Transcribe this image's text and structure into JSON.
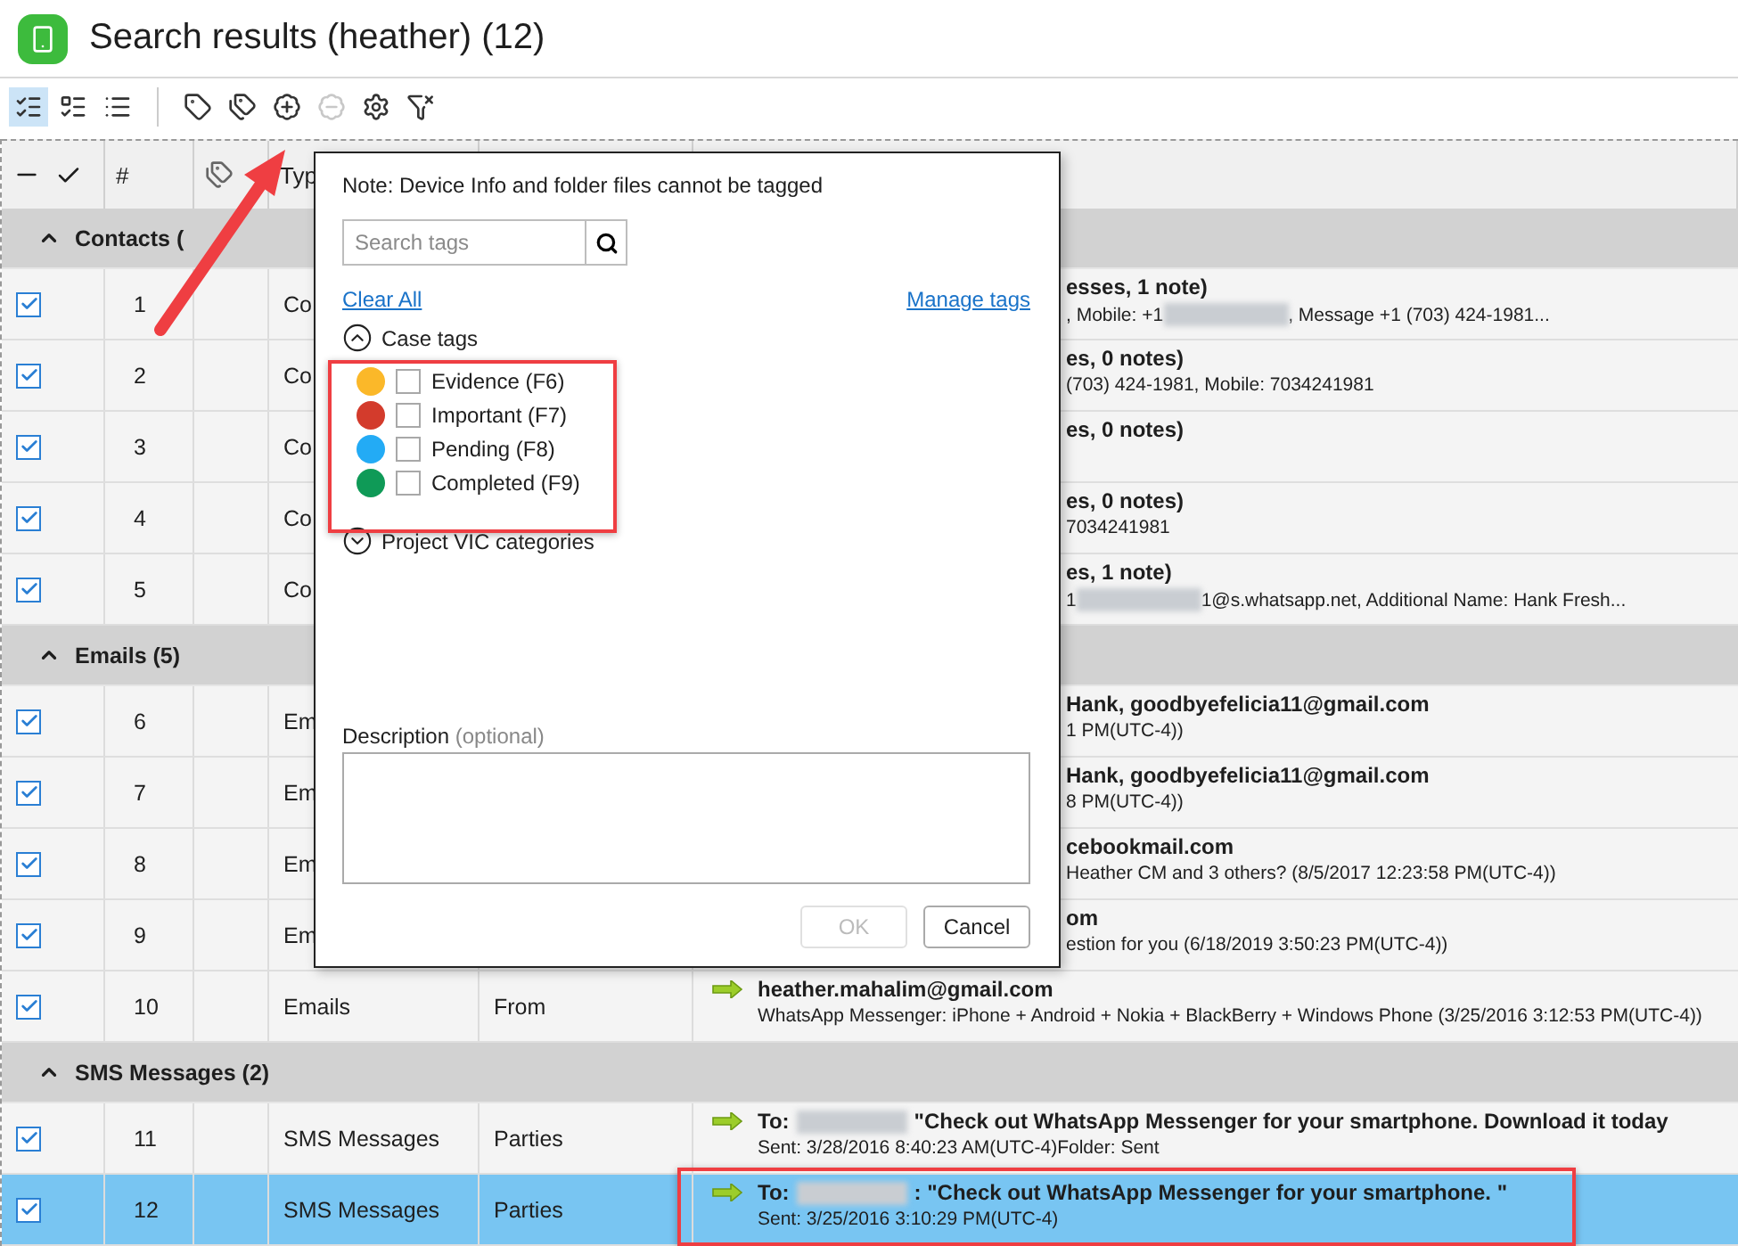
{
  "title": "Search results (heather) (12)",
  "toolbar": [
    {
      "kind": "view-details",
      "selected": true
    },
    {
      "kind": "view-checked",
      "selected": false
    },
    {
      "kind": "view-list",
      "selected": false
    },
    {
      "kind": "tag-check",
      "disabled": false
    },
    {
      "kind": "tag-list",
      "disabled": false
    },
    {
      "kind": "tag-add",
      "disabled": false
    },
    {
      "kind": "tag-remove",
      "disabled": true
    },
    {
      "kind": "tag-settings",
      "disabled": false
    },
    {
      "kind": "filter-clear",
      "disabled": false
    }
  ],
  "columns": [
    {
      "kind": "check-all"
    },
    {
      "kind": "text",
      "label": "#"
    },
    {
      "kind": "tag"
    },
    {
      "kind": "text",
      "label": "Typ"
    }
  ],
  "groups": [
    {
      "label": "Contacts (",
      "expanded": true,
      "rows": [
        {
          "number": "1",
          "checked": true,
          "selected": false,
          "type": "Co",
          "arrow": false,
          "title": [
            {
              "kind": "text",
              "text": "esses, 1 note)"
            }
          ],
          "sub": [
            {
              "kind": "text",
              "text": ", Mobile: +1"
            },
            {
              "kind": "redacted"
            },
            {
              "kind": "text",
              "text": ", Message +1 (703) 424-1981..."
            }
          ]
        },
        {
          "number": "2",
          "checked": true,
          "selected": false,
          "type": "Co",
          "arrow": false,
          "title": [
            {
              "kind": "text",
              "text": "es, 0 notes)"
            }
          ],
          "sub": [
            {
              "kind": "text",
              "text": "(703) 424-1981, Mobile: 7034241981"
            }
          ]
        },
        {
          "number": "3",
          "checked": true,
          "selected": false,
          "type": "Co",
          "arrow": false,
          "title": [
            {
              "kind": "text",
              "text": "es, 0 notes)"
            }
          ]
        },
        {
          "number": "4",
          "checked": true,
          "selected": false,
          "type": "Co",
          "arrow": false,
          "title": [
            {
              "kind": "text",
              "text": "es, 0 notes)"
            }
          ],
          "sub": [
            {
              "kind": "text",
              "text": "7034241981"
            }
          ]
        },
        {
          "number": "5",
          "checked": true,
          "selected": false,
          "type": "Co",
          "arrow": false,
          "title": [
            {
              "kind": "text",
              "text": "es, 1 note)"
            }
          ],
          "sub": [
            {
              "kind": "text",
              "text": "1"
            },
            {
              "kind": "redacted"
            },
            {
              "kind": "text",
              "text": "1@s.whatsapp.net, Additional Name: Hank Fresh..."
            }
          ]
        }
      ]
    },
    {
      "label": "Emails (5)",
      "expanded": true,
      "rows": [
        {
          "number": "6",
          "checked": true,
          "selected": false,
          "type": "Em",
          "arrow": false,
          "title": [
            {
              "kind": "text",
              "text": "Hank, goodbyefelicia11@gmail.com"
            }
          ],
          "sub": [
            {
              "kind": "text",
              "text": "1 PM(UTC-4))"
            }
          ]
        },
        {
          "number": "7",
          "checked": true,
          "selected": false,
          "type": "Em",
          "arrow": false,
          "title": [
            {
              "kind": "text",
              "text": "Hank, goodbyefelicia11@gmail.com"
            }
          ],
          "sub": [
            {
              "kind": "text",
              "text": "8 PM(UTC-4))"
            }
          ]
        },
        {
          "number": "8",
          "checked": true,
          "selected": false,
          "type": "Em",
          "arrow": false,
          "title": [
            {
              "kind": "text",
              "text": "cebookmail.com"
            }
          ],
          "sub": [
            {
              "kind": "text",
              "text": "Heather CM and 3 others? (8/5/2017 12:23:58 PM(UTC-4))"
            }
          ]
        },
        {
          "number": "9",
          "checked": true,
          "selected": false,
          "type": "Em",
          "arrow": false,
          "title": [
            {
              "kind": "text",
              "text": "om"
            }
          ],
          "sub": [
            {
              "kind": "text",
              "text": "estion for you (6/18/2019 3:50:23 PM(UTC-4))"
            }
          ]
        },
        {
          "number": "10",
          "checked": true,
          "selected": false,
          "type": "Emails",
          "column_4": "From",
          "arrow": true,
          "title": [
            {
              "kind": "text",
              "text": "heather.mahalim@gmail.com"
            }
          ],
          "sub": [
            {
              "kind": "text",
              "text": "WhatsApp Messenger: iPhone + Android + Nokia + BlackBerry + Windows Phone (3/25/2016 3:12:53 PM(UTC-4))"
            }
          ]
        }
      ]
    },
    {
      "label": "SMS Messages (2)",
      "expanded": true,
      "rows": [
        {
          "number": "11",
          "checked": true,
          "selected": false,
          "type": "SMS Messages",
          "column_4": "Parties",
          "arrow": true,
          "title": [
            {
              "kind": "text",
              "text": "To:"
            },
            {
              "kind": "redacted"
            },
            {
              "kind": "text",
              "text": "\"Check out WhatsApp Messenger for your smartphone. Download it today"
            }
          ],
          "sub": [
            {
              "kind": "text",
              "text": "Sent: 3/28/2016 8:40:23 AM(UTC-4)Folder: Sent"
            }
          ]
        },
        {
          "number": "12",
          "checked": true,
          "selected": true,
          "type": "SMS Messages",
          "column_4": "Parties",
          "arrow": true,
          "title": [
            {
              "kind": "text",
              "text": "To:"
            },
            {
              "kind": "redacted"
            },
            {
              "kind": "text",
              "text": ": \"Check out WhatsApp Messenger for your smartphone. \""
            }
          ],
          "sub": [
            {
              "kind": "text",
              "text": "Sent: 3/25/2016 3:10:29 PM(UTC-4)"
            }
          ]
        }
      ]
    }
  ],
  "popup": {
    "note": "Note: Device Info and folder files cannot be tagged",
    "search": {
      "placeholder": "Search tags"
    },
    "clear_all": "Clear All",
    "manage_tags": "Manage tags",
    "sections": [
      {
        "label": "Case tags",
        "expanded": true,
        "tags": [
          {
            "label": "Evidence (F6)",
            "color": "#fbb829",
            "checked": false
          },
          {
            "label": "Important (F7)",
            "color": "#d33b2c",
            "checked": false
          },
          {
            "label": "Pending (F8)",
            "color": "#23abf5",
            "checked": false
          },
          {
            "label": "Completed (F9)",
            "color": "#0f9a57",
            "checked": false
          }
        ]
      },
      {
        "label": "Project VIC categories",
        "expanded": false
      }
    ],
    "description_label": "Description",
    "description_hint": "(optional)",
    "buttons": [
      {
        "label": "OK",
        "disabled": true
      },
      {
        "label": "Cancel",
        "disabled": false
      }
    ]
  }
}
